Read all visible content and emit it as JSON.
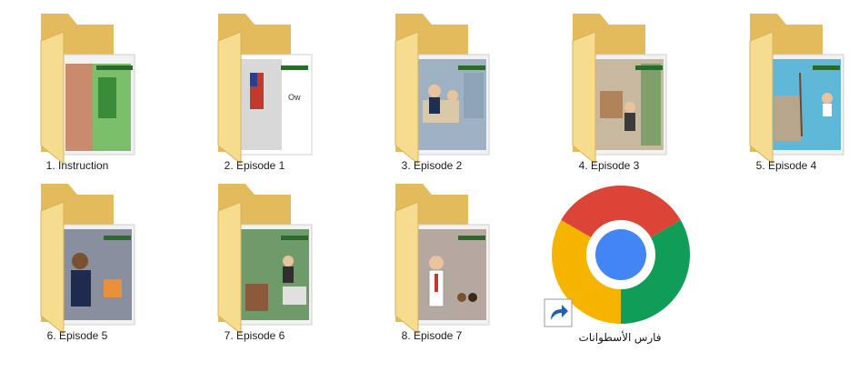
{
  "folders": [
    {
      "label": "1. Instruction",
      "scene": "#7bbf6a"
    },
    {
      "label": "2. Episode 1",
      "scene": "#d8d8d8"
    },
    {
      "label": "3. Episode 2",
      "scene": "#9fb2c4"
    },
    {
      "label": "4. Episode 3",
      "scene": "#c9b8a0"
    },
    {
      "label": "5. Episode 4",
      "scene": "#5fb8d8"
    },
    {
      "label": "6. Episode 5",
      "scene": "#8a8fa0"
    },
    {
      "label": "7. Episode 6",
      "scene": "#6f9a6a"
    },
    {
      "label": "8. Episode 7",
      "scene": "#b5a8a0"
    }
  ],
  "shortcut": {
    "label": "فارس الأسطوانات",
    "icon": "chrome-shortcut-icon"
  },
  "colors": {
    "folder_back": "#e9c56a",
    "folder_front": "#f6dc8e",
    "chrome_red": "#db4437",
    "chrome_green": "#0f9d58",
    "chrome_yellow": "#f4b400",
    "chrome_blue": "#4285f4"
  }
}
